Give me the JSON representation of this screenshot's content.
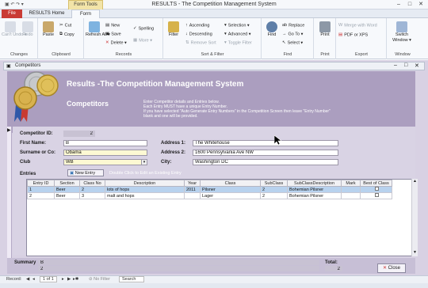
{
  "window": {
    "title": "RESULTS - The Competition Management System",
    "context_tab": "Form Tools",
    "quick_access": "▣ ↶ ↷ ▾"
  },
  "tabs": [
    {
      "label": "File"
    },
    {
      "label": "RESULTS Home"
    },
    {
      "label": "Form"
    }
  ],
  "ribbon": {
    "views": {
      "undo": "Can't Undo ▾",
      "redo": "Redo"
    },
    "clipboard": {
      "label": "Clipboard",
      "paste": "Paste",
      "cut": "Cut",
      "copy": "Copy"
    },
    "records": {
      "label": "Records",
      "refresh": "Refresh All ▾",
      "new": "New",
      "save": "Save",
      "delete": "Delete ▾",
      "spelling": "Spelling",
      "more": "More ▾"
    },
    "sort_filter": {
      "label": "Sort & Filter",
      "filter": "Filter",
      "ascending": "Ascending",
      "descending": "Descending",
      "remove_sort": "Remove Sort",
      "selection": "Selection ▾",
      "advanced": "Advanced ▾",
      "toggle_filter": "Toggle Filter"
    },
    "find": {
      "label": "Find",
      "find": "Find",
      "replace": "Replace",
      "goto": "Go To ▾",
      "select": "Select ▾"
    },
    "print": {
      "label": "Print",
      "print": "Print"
    },
    "export": {
      "label": "Export",
      "merge": "Merge with Word",
      "pdf": "PDF or XPS"
    },
    "window": {
      "label": "Window",
      "switch": "Switch Window ▾"
    },
    "changes_label": "Changes"
  },
  "form": {
    "window_title": "Competitors",
    "banner_title": "Results -The Competition Management System",
    "banner_subtitle": "Competitors",
    "instructions": "Enter Competitor details and Entries below.\nEach Entry MUST have a unique Entry Number.\nIf you have selected \"Auto Generate Entry Numbers\" in the Competition Screen then leave \"Entry Number\"\nblank and one will be provided.",
    "fields": {
      "competitor_id_label": "Competitor ID:",
      "competitor_id": "2",
      "first_name_label": "First Name:",
      "first_name": "B",
      "surname_label": "Surname or Co:",
      "surname": "Obama",
      "club_label": "Club",
      "club": "WB",
      "address1_label": "Address 1:",
      "address1": "The Whitehouse",
      "address2_label": "Address 2:",
      "address2": "1600 Pennsylvania Ave NW",
      "city_label": "City:",
      "city": "Washington DC"
    },
    "entries_label": "Entries",
    "new_entry_button": "New Entry",
    "new_entry_hint": "Double Click to Edit an Existing Entry",
    "grid": {
      "columns": [
        "Entry ID",
        "Section",
        "Class No",
        "Description",
        "Year",
        "Class",
        "SubClass",
        "SubClassDescription",
        "Mark",
        "Best of Class"
      ],
      "rows": [
        [
          "1",
          "Beer",
          "2",
          "lots of hops",
          "2011",
          "Pilsner",
          "2",
          "Bohemian Pilsner",
          "",
          ""
        ],
        [
          "2",
          "Beer",
          "3",
          "malt and hops",
          "",
          "Lager",
          "2",
          "Bohemian Pilsner",
          "",
          ""
        ]
      ]
    },
    "summary_label": "Summary",
    "summary_value_1": "B",
    "summary_value_2": "2",
    "total_label": "Total:",
    "total_value": "2",
    "close_button": "Close"
  },
  "navbar": {
    "record_label": "Record:",
    "first": "◀",
    "prev": "◂",
    "position": "1 of 1",
    "next": "▸",
    "last": "▶",
    "new": "▸✱",
    "filter": "No Filter",
    "search": "Search"
  },
  "colors": {
    "file_tab": "#c93b34",
    "form_header": "#ab9ebf",
    "form_body": "#d9d3e4",
    "selected_row": "#b8d2ee"
  }
}
